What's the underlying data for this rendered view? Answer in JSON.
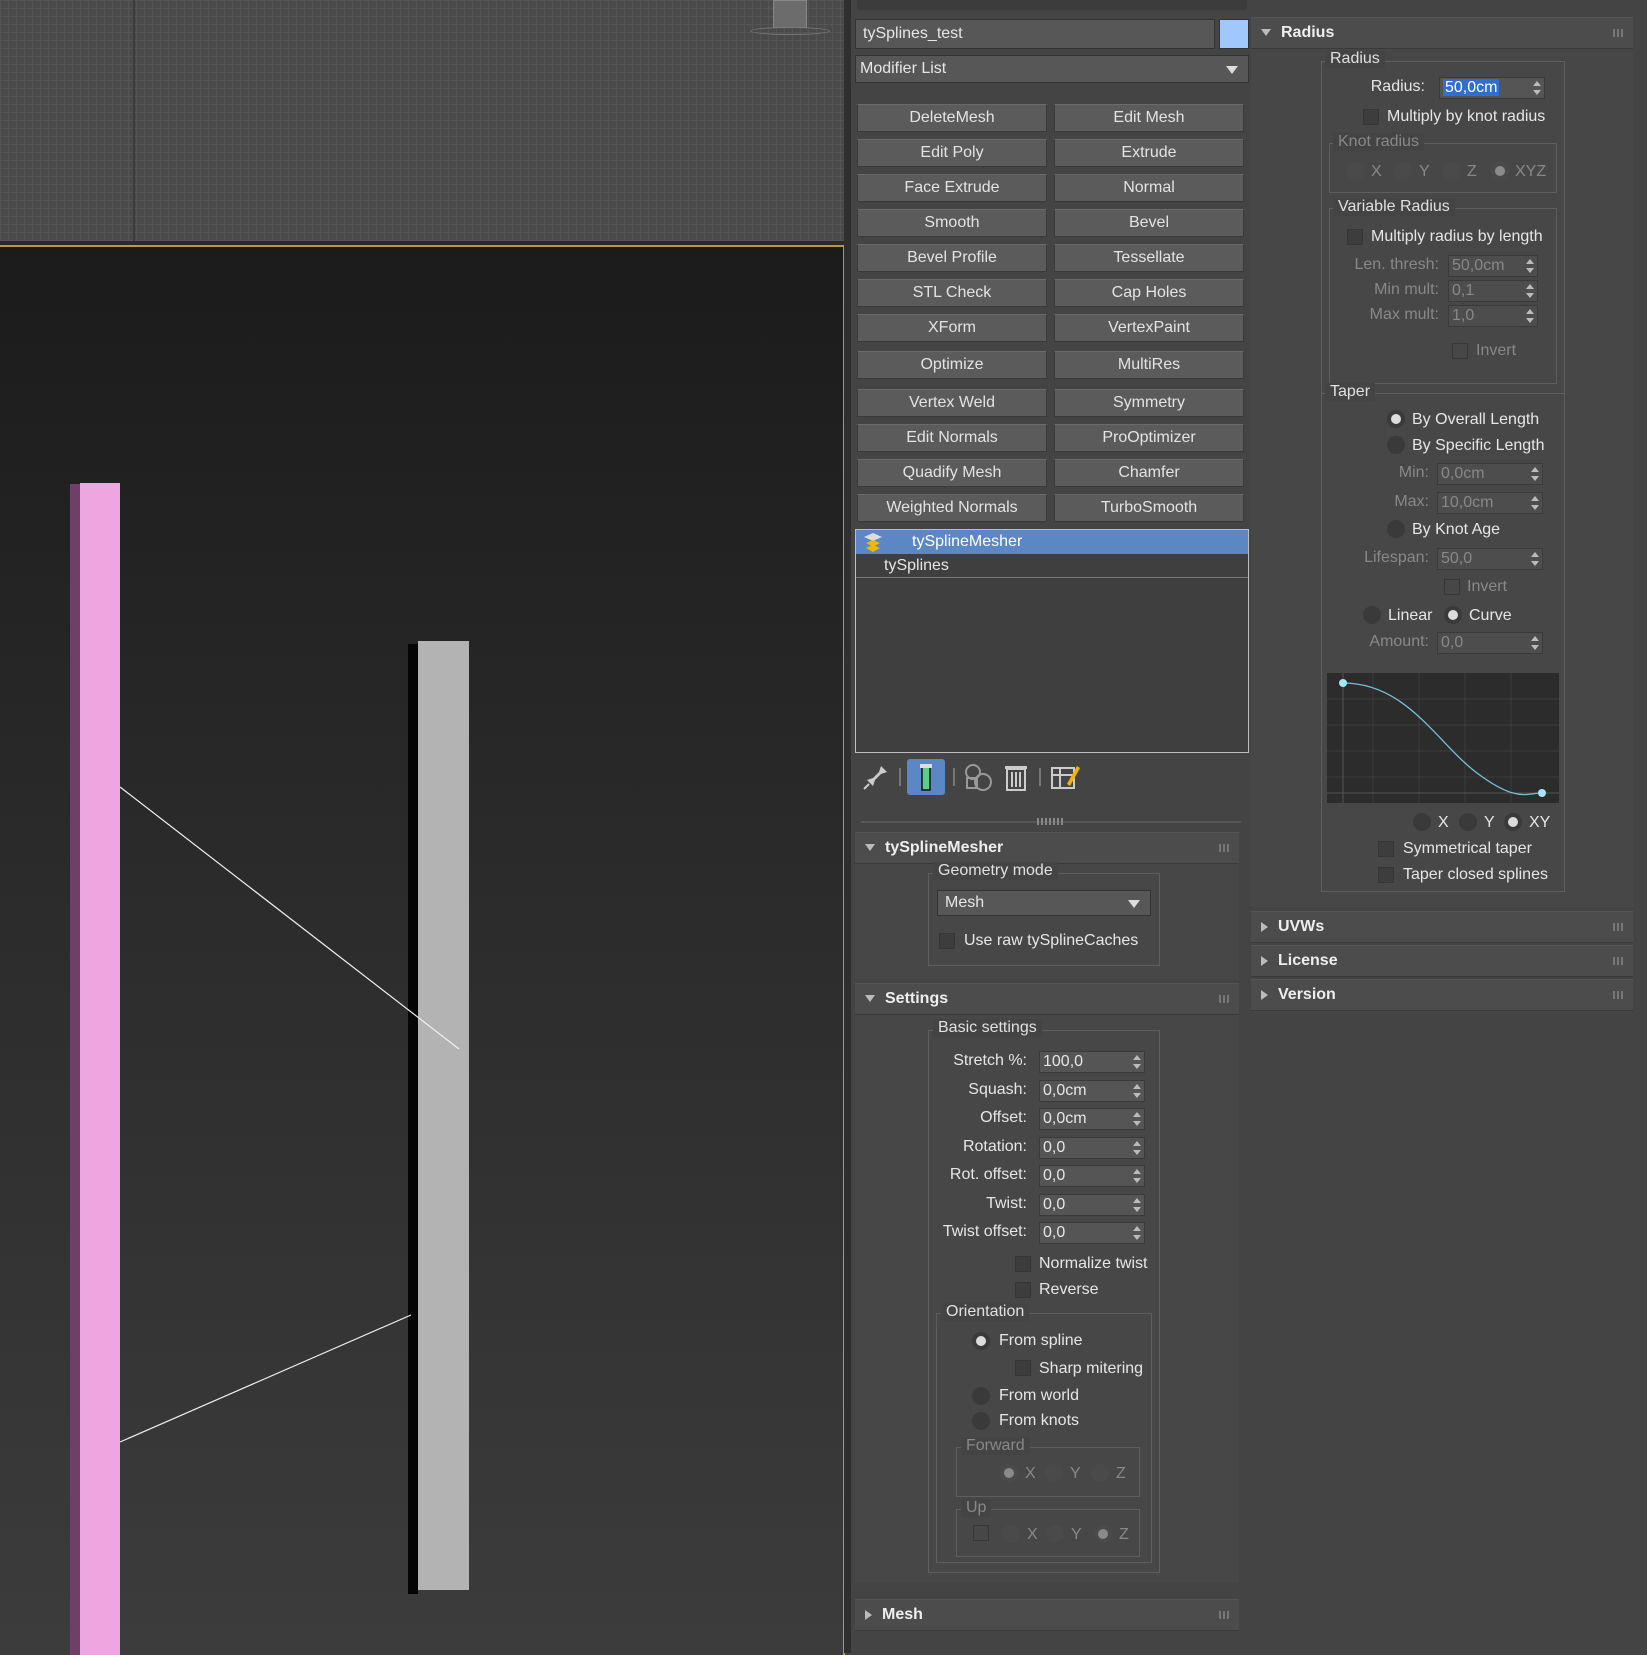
{
  "object": {
    "name": "tySplines_test",
    "color": "#9ec8ff"
  },
  "modifier_list": {
    "label": "Modifier List"
  },
  "modifier_buttons": [
    "DeleteMesh",
    "Edit Mesh",
    "Edit Poly",
    "Extrude",
    "Face Extrude",
    "Normal",
    "Smooth",
    "Bevel",
    "Bevel Profile",
    "Tessellate",
    "STL Check",
    "Cap Holes",
    "XForm",
    "VertexPaint",
    "Optimize",
    "MultiRes",
    "Vertex Weld",
    "Symmetry",
    "Edit Normals",
    "ProOptimizer",
    "Quadify Mesh",
    "Chamfer",
    "Weighted Normals",
    "TurboSmooth"
  ],
  "stack": {
    "items": [
      "tySplineMesher",
      "tySplines"
    ],
    "selected_index": 0
  },
  "stack_tools": [
    "pin-stack-icon",
    "show-end-result-icon",
    "make-unique-icon",
    "remove-modifier-icon",
    "configure-modifier-sets-icon"
  ],
  "rollouts": {
    "mesher": {
      "title": "tySplineMesher",
      "geometry_mode_label": "Geometry mode",
      "geometry_mode_value": "Mesh",
      "use_raw_label": "Use raw tySplineCaches"
    },
    "settings": {
      "title": "Settings",
      "basic_label": "Basic settings",
      "fields": [
        {
          "label": "Stretch %:",
          "value": "100,0"
        },
        {
          "label": "Squash:",
          "value": "0,0cm"
        },
        {
          "label": "Offset:",
          "value": "0,0cm"
        },
        {
          "label": "Rotation:",
          "value": "0,0"
        },
        {
          "label": "Rot. offset:",
          "value": "0,0"
        },
        {
          "label": "Twist:",
          "value": "0,0"
        },
        {
          "label": "Twist offset:",
          "value": "0,0"
        }
      ],
      "normalize_twist": "Normalize twist",
      "reverse": "Reverse",
      "orientation": {
        "label": "Orientation",
        "from_spline": "From spline",
        "sharp_mitering": "Sharp mitering",
        "from_world": "From world",
        "from_knots": "From knots",
        "forward_label": "Forward",
        "up_label": "Up",
        "axes": [
          "X",
          "Y",
          "Z"
        ]
      }
    },
    "mesh": {
      "title": "Mesh"
    },
    "radius": {
      "title": "Radius",
      "group_label": "Radius",
      "radius_label": "Radius:",
      "radius_value": "50,0cm",
      "multiply_knot": "Multiply by knot radius",
      "knot_radius_label": "Knot radius",
      "knot_axes": [
        "X",
        "Y",
        "Z",
        "XYZ"
      ],
      "variable_label": "Variable Radius",
      "multiply_length": "Multiply radius by length",
      "len_thresh_label": "Len. thresh:",
      "len_thresh_value": "50,0cm",
      "min_mult_label": "Min mult:",
      "min_mult_value": "0,1",
      "max_mult_label": "Max mult:",
      "max_mult_value": "1,0",
      "invert": "Invert"
    },
    "taper": {
      "label": "Taper",
      "by_overall": "By Overall Length",
      "by_specific": "By Specific Length",
      "min_label": "Min:",
      "min_value": "0,0cm",
      "max_label": "Max:",
      "max_value": "10,0cm",
      "by_knot_age": "By Knot Age",
      "lifespan_label": "Lifespan:",
      "lifespan_value": "50,0",
      "invert": "Invert",
      "linear": "Linear",
      "curve": "Curve",
      "amount_label": "Amount:",
      "amount_value": "0,0",
      "curve_axes": [
        "X",
        "Y",
        "XY"
      ],
      "symmetrical": "Symmetrical taper",
      "taper_closed": "Taper closed splines"
    },
    "uvws": {
      "title": "UVWs"
    },
    "license": {
      "title": "License"
    },
    "version": {
      "title": "Version"
    }
  },
  "colors": {
    "selection": "#5b87c4",
    "viewport_border": "#b79a3a",
    "pink_mesh": "#eea6e0",
    "gray_mesh": "#b3b3b3"
  }
}
